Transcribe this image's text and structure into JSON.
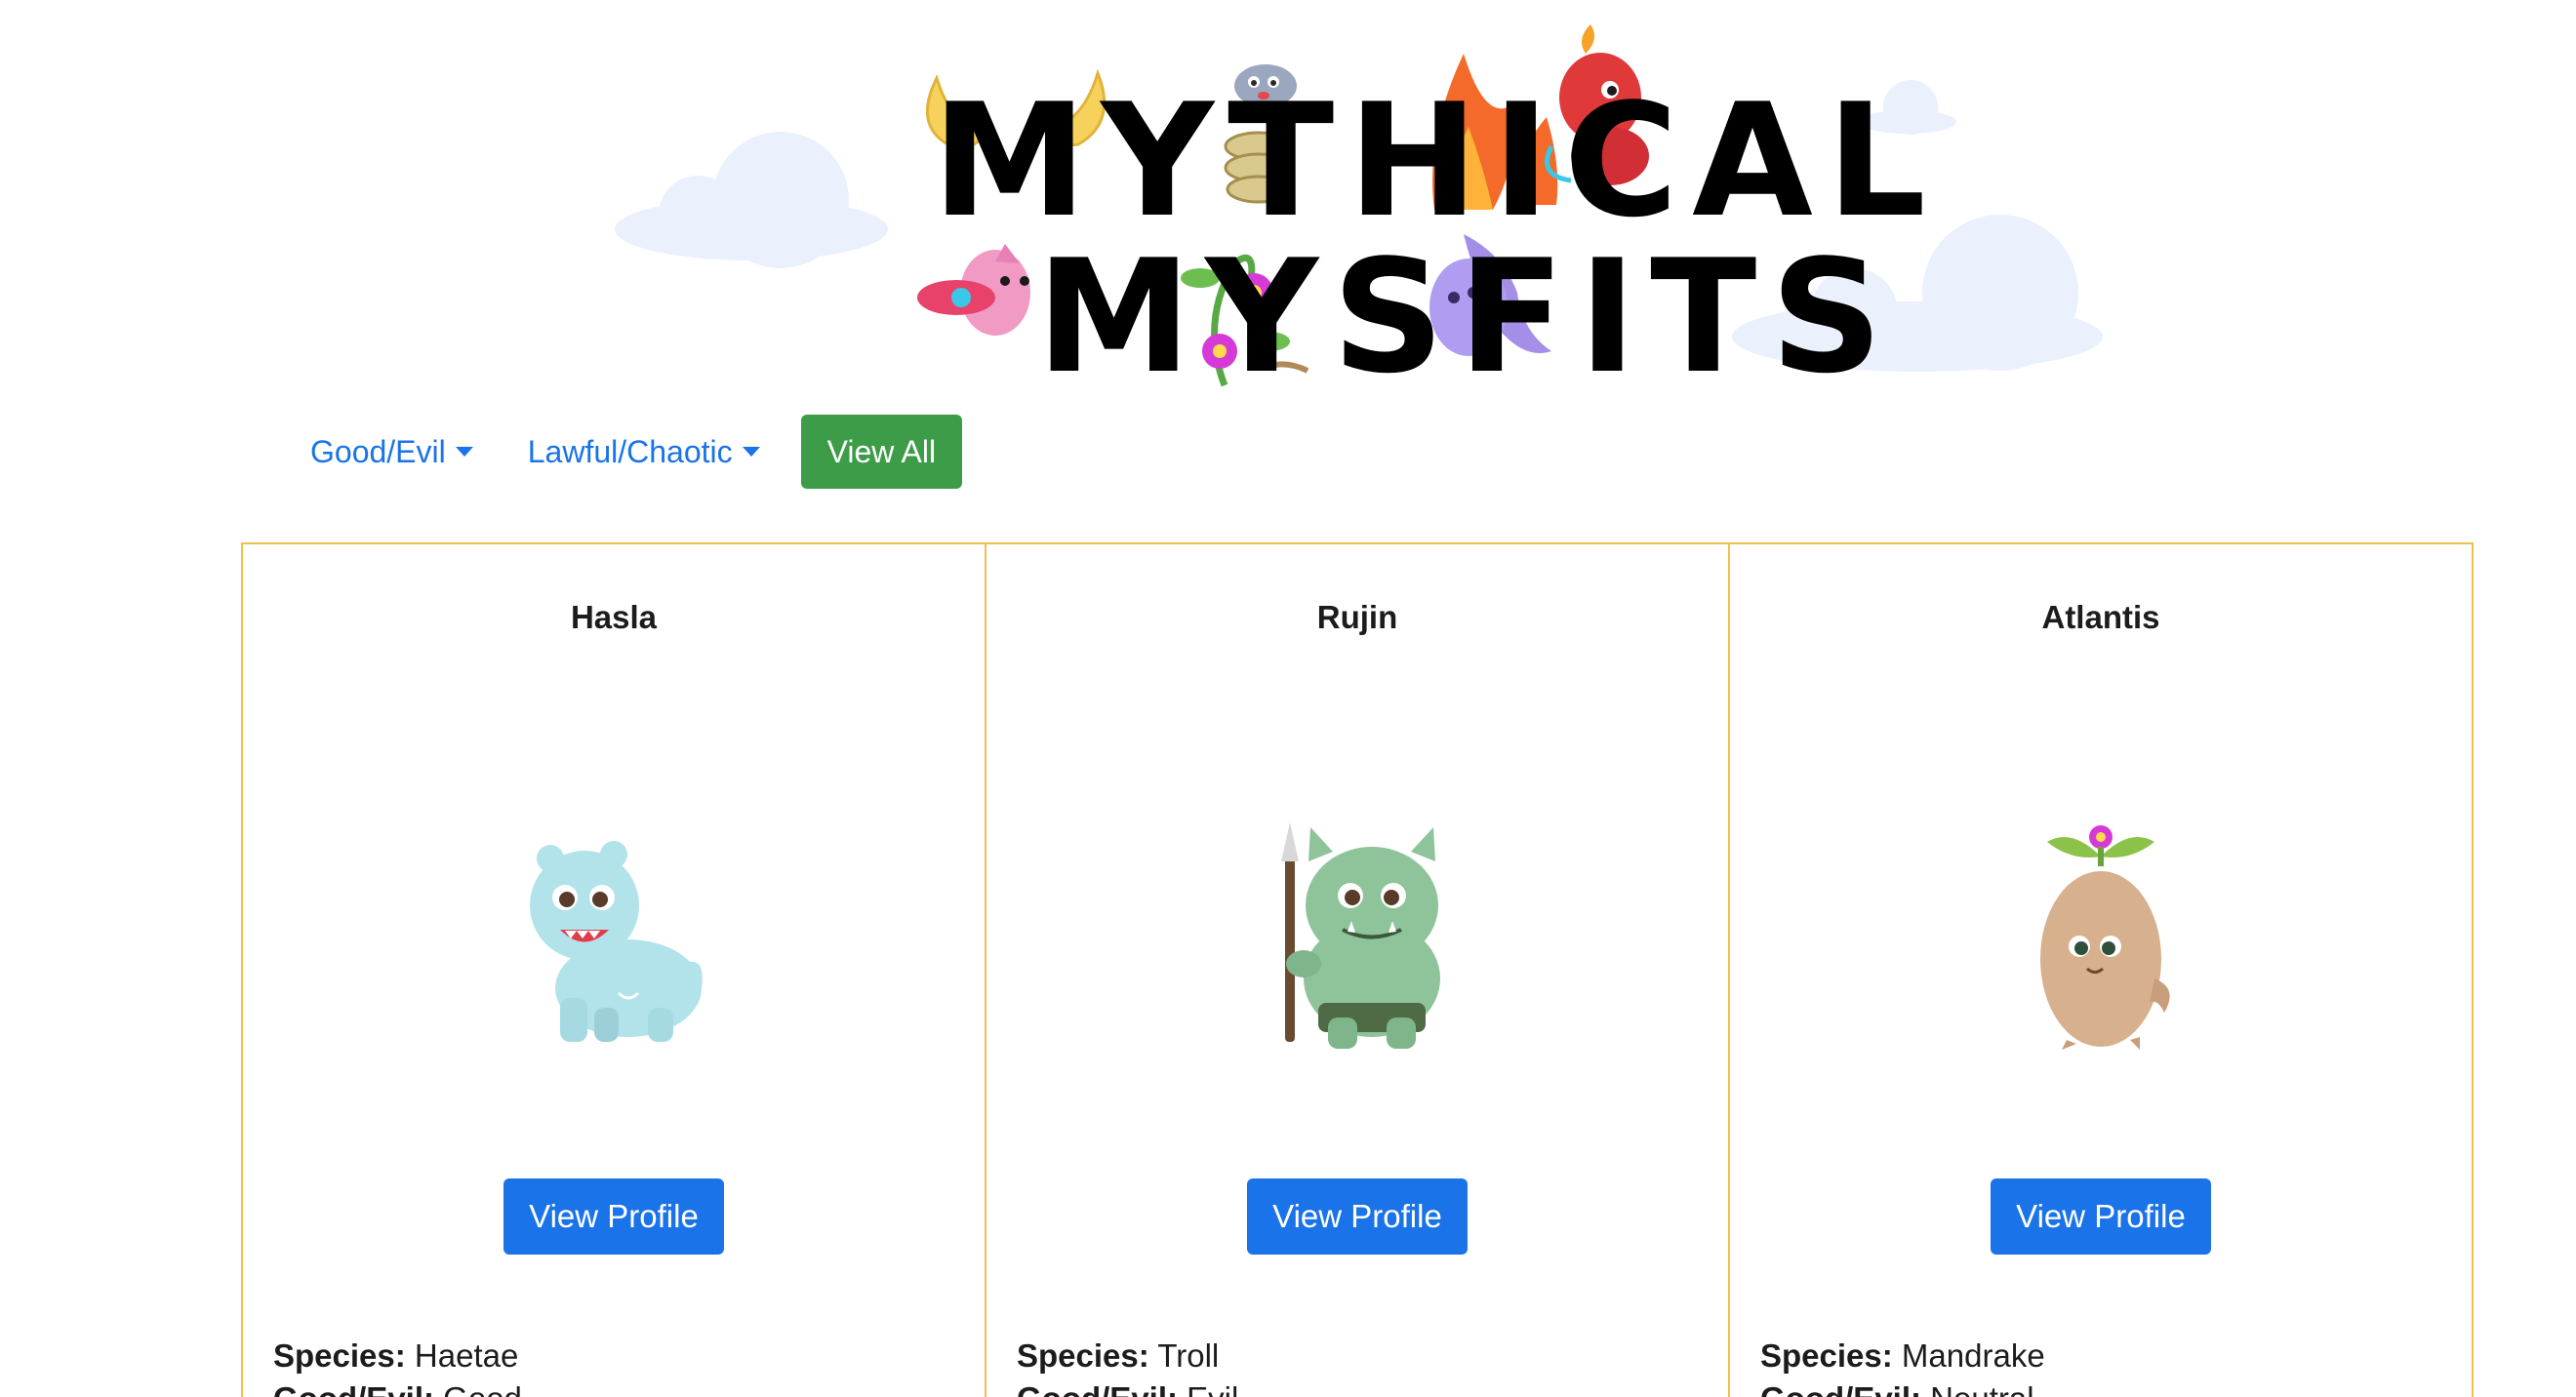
{
  "header": {
    "logo_line1": "MYTHICAL",
    "logo_line2": "MYSFITS"
  },
  "nav": {
    "good_evil_label": "Good/Evil",
    "lawful_chaotic_label": "Lawful/Chaotic",
    "view_all_label": "View All"
  },
  "colors": {
    "link_blue": "#1a73e8",
    "view_all_green": "#3d9c47",
    "card_border": "#f2bf4a"
  },
  "cards": [
    {
      "name": "Hasla",
      "image_icon": "blue-yeti-creature-icon",
      "button_label": "View Profile",
      "species_label": "Species:",
      "species": "Haetae",
      "good_evil_label": "Good/Evil:",
      "good_evil": "Good"
    },
    {
      "name": "Rujin",
      "image_icon": "green-troll-creature-icon",
      "button_label": "View Profile",
      "species_label": "Species:",
      "species": "Troll",
      "good_evil_label": "Good/Evil:",
      "good_evil": "Evil"
    },
    {
      "name": "Atlantis",
      "image_icon": "mandrake-creature-icon",
      "button_label": "View Profile",
      "species_label": "Species:",
      "species": "Mandrake",
      "good_evil_label": "Good/Evil:",
      "good_evil": "Neutral"
    }
  ]
}
